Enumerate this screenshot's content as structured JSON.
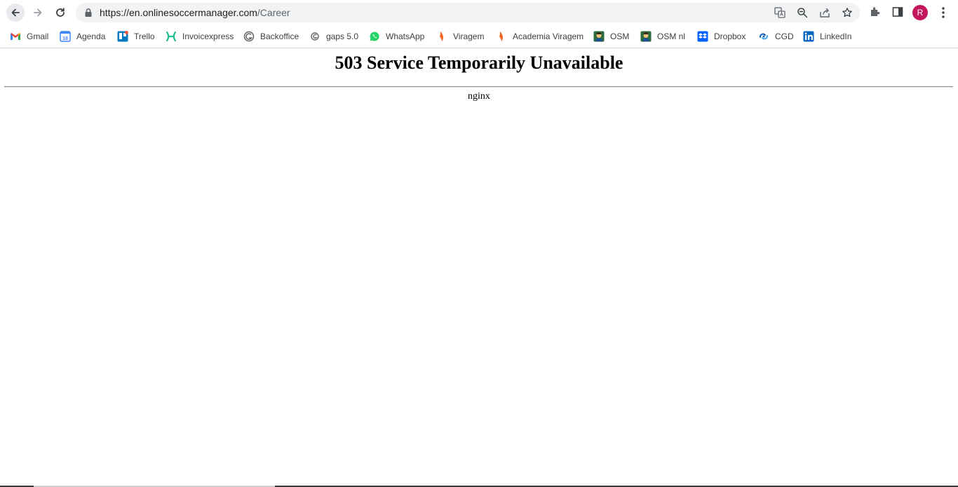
{
  "browser": {
    "url_host": "https://en.onlinesoccermanager.com",
    "url_path": "/Career",
    "profile_initial": "R",
    "accent_color": "#c2185b"
  },
  "bookmarks": [
    {
      "label": "Gmail",
      "icon": "gmail-icon"
    },
    {
      "label": "Agenda",
      "icon": "calendar-icon"
    },
    {
      "label": "Trello",
      "icon": "trello-icon"
    },
    {
      "label": "Invoicexpress",
      "icon": "invoicexpress-icon"
    },
    {
      "label": "Backoffice",
      "icon": "backoffice-icon"
    },
    {
      "label": "gaps 5.0",
      "icon": "gaps-icon"
    },
    {
      "label": "WhatsApp",
      "icon": "whatsapp-icon"
    },
    {
      "label": "Viragem",
      "icon": "viragem-icon"
    },
    {
      "label": "Academia Viragem",
      "icon": "viragem-icon"
    },
    {
      "label": "OSM",
      "icon": "osm-icon"
    },
    {
      "label": "OSM nl",
      "icon": "osm-icon"
    },
    {
      "label": "Dropbox",
      "icon": "dropbox-icon"
    },
    {
      "label": "CGD",
      "icon": "cgd-icon"
    },
    {
      "label": "LinkedIn",
      "icon": "linkedin-icon"
    }
  ],
  "page": {
    "heading": "503 Service Temporarily Unavailable",
    "server": "nginx"
  }
}
